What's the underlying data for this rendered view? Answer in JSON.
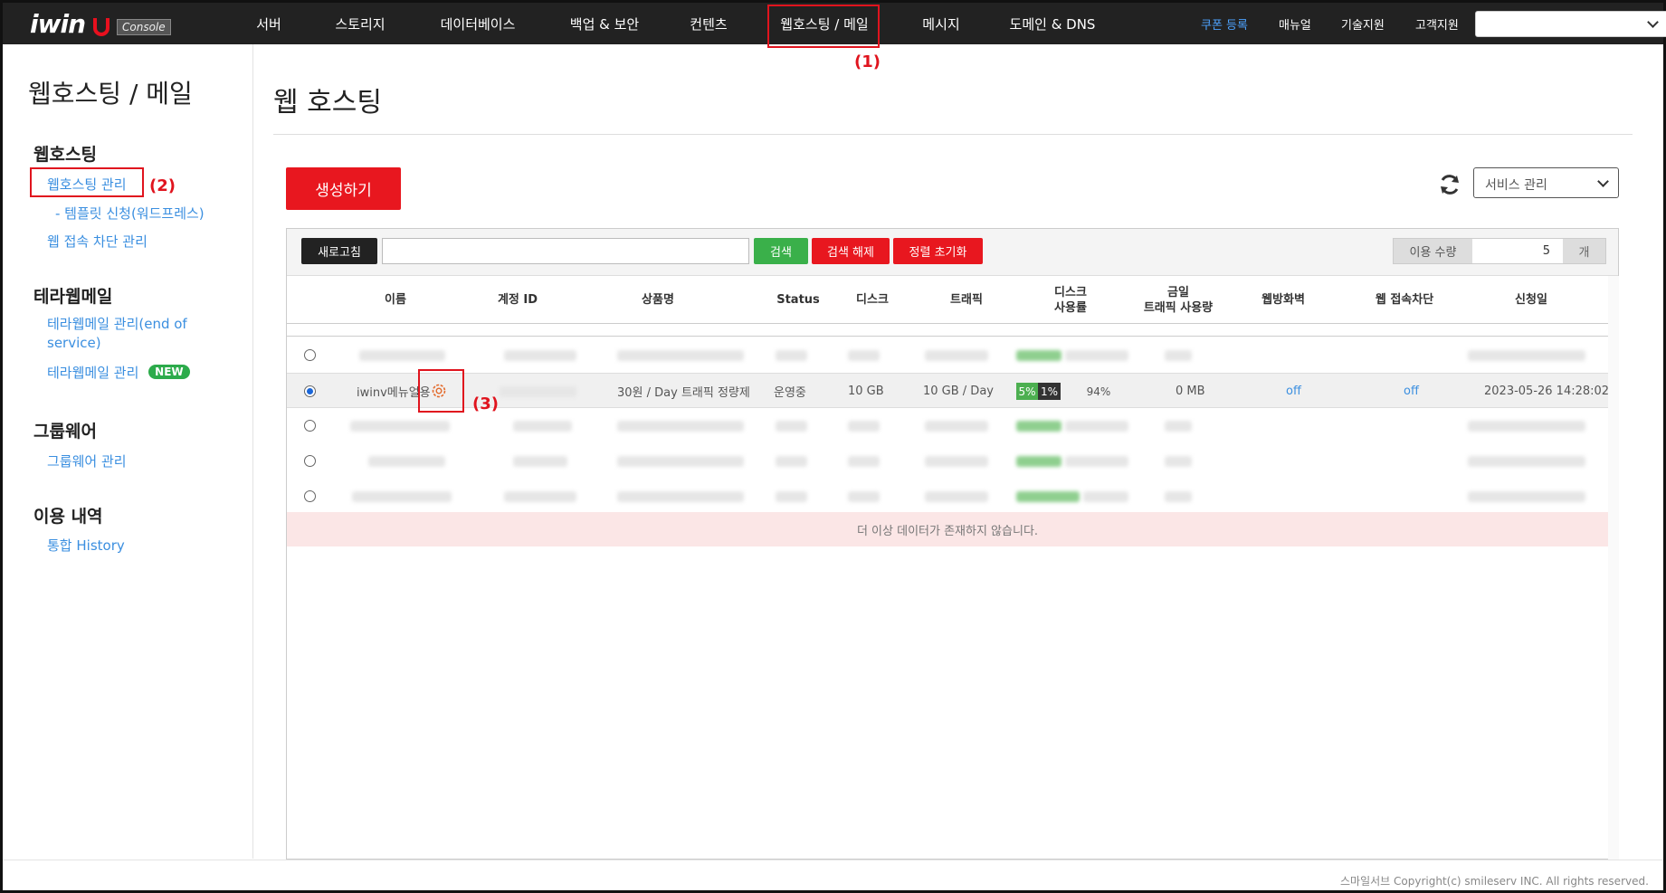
{
  "logo": {
    "text": "iwin",
    "badge": "Console"
  },
  "nav": {
    "items": [
      "서버",
      "스토리지",
      "데이터베이스",
      "백업 & 보안",
      "컨텐츠",
      "웹호스팅 / 메일",
      "메시지",
      "도메인 & DNS"
    ],
    "right": [
      "쿠폰 등록",
      "매뉴얼",
      "기술지원",
      "고객지원"
    ],
    "select_value": ""
  },
  "annotations": [
    "(1)",
    "(2)",
    "(3)"
  ],
  "sidebar": {
    "title": "웹호스팅 / 메일",
    "sections": [
      {
        "title": "웹호스팅",
        "links": [
          "웹호스팅 관리",
          "- 템플릿 신청(워드프레스)",
          "웹 접속 차단 관리"
        ]
      },
      {
        "title": "테라웹메일",
        "links": [
          "테라웹메일 관리(end of service)",
          "테라웹메일 관리"
        ],
        "badge": "NEW"
      },
      {
        "title": "그룹웨어",
        "links": [
          "그룹웨어 관리"
        ]
      },
      {
        "title": "이용 내역",
        "links": [
          "통합 History"
        ]
      }
    ]
  },
  "main": {
    "title": "웹 호스팅",
    "create_button": "생성하기",
    "service_select": "서비스 관리",
    "toolbar": {
      "refresh": "새로고침",
      "search_value": "",
      "search": "검색",
      "clear": "검색 해제",
      "reset_sort": "정렬 초기화",
      "qty_label": "이용 수량",
      "qty_value": "5",
      "qty_unit": "개"
    },
    "columns": [
      "이름",
      "계정 ID",
      "상품명",
      "Status",
      "디스크",
      "트래픽",
      "디스크\n사용률",
      "금일\n트래픽 사용량",
      "웹방화벽",
      "웹 접속차단",
      "신청일"
    ],
    "selected_row": {
      "name": "iwinv메뉴얼용",
      "account_id": "",
      "product": "30원 / Day 트래픽 정량제",
      "status": "운영중",
      "disk": "10 GB",
      "traffic": "10 GB / Day",
      "disk_usage": {
        "seg1": "5%",
        "seg2": "1%",
        "rest": "94%"
      },
      "today_traffic": "0 MB",
      "waf": "off",
      "block": "off",
      "date": "2023-05-26 14:28:02"
    },
    "no_more": "더 이상 데이터가 존재하지 않습니다."
  },
  "footer": "스마일서브 Copyright(c) smileserv INC. All rights reserved.",
  "colors": {
    "accent_red": "#e8171f",
    "link_blue": "#3b8fe0",
    "search_green": "#3ab04a",
    "topbar": "#222222"
  }
}
